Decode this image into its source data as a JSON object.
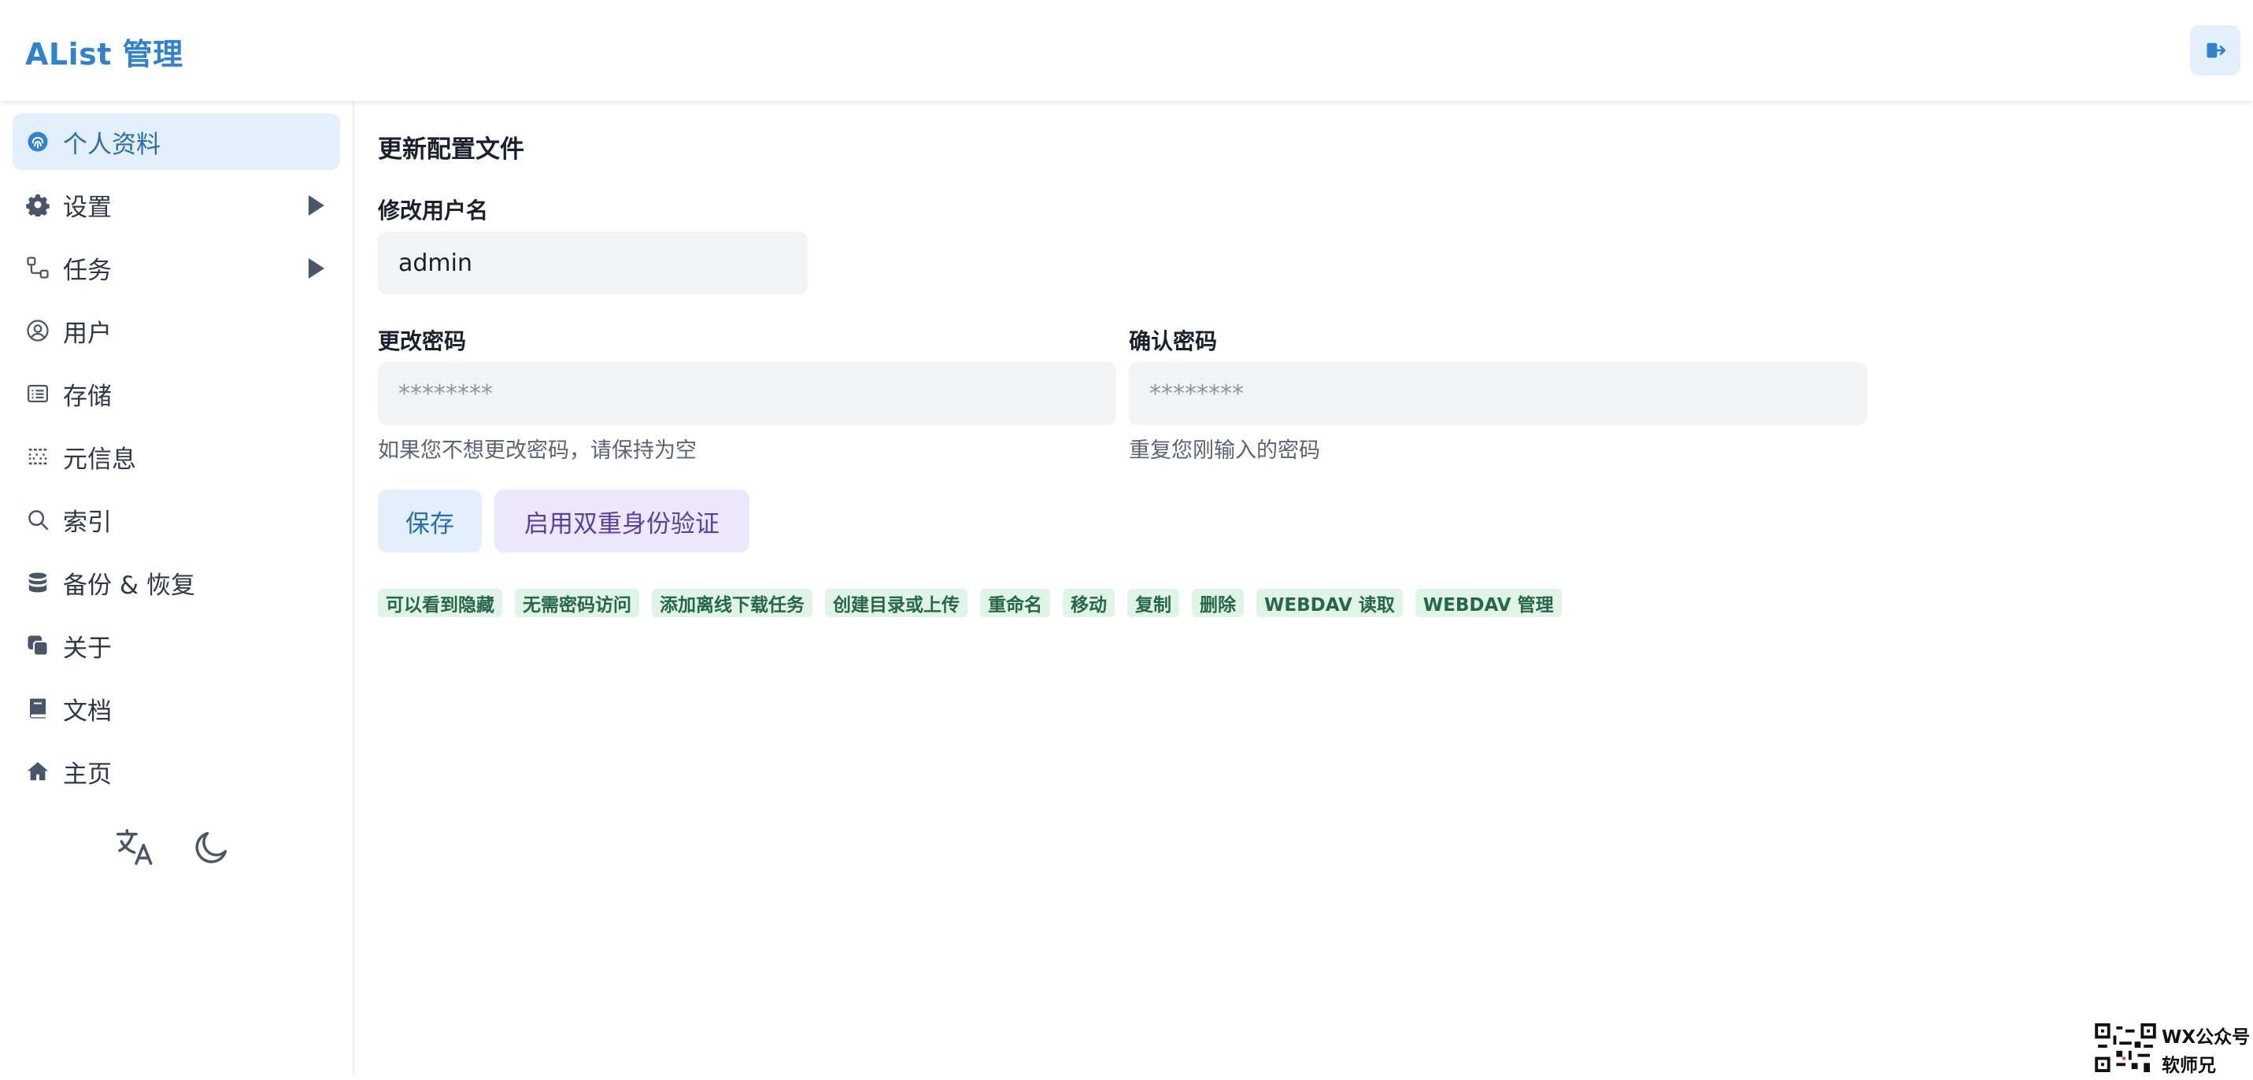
{
  "header": {
    "brand": "AList 管理",
    "logout_icon": "logout-icon"
  },
  "sidebar": {
    "items": [
      {
        "label": "个人资料",
        "icon": "fingerprint-icon",
        "active": true
      },
      {
        "label": "设置",
        "icon": "gear-icon",
        "expandable": true
      },
      {
        "label": "任务",
        "icon": "workflow-icon",
        "expandable": true
      },
      {
        "label": "用户",
        "icon": "user-circle-icon"
      },
      {
        "label": "存储",
        "icon": "storage-list-icon"
      },
      {
        "label": "元信息",
        "icon": "metadata-icon"
      },
      {
        "label": "索引",
        "icon": "search-icon"
      },
      {
        "label": "备份 & 恢复",
        "icon": "database-icon"
      },
      {
        "label": "关于",
        "icon": "copy-stack-icon"
      },
      {
        "label": "文档",
        "icon": "book-icon"
      },
      {
        "label": "主页",
        "icon": "home-icon"
      }
    ],
    "tools": {
      "language_icon": "translate-icon",
      "theme_icon": "moon-icon"
    }
  },
  "main": {
    "title": "更新配置文件",
    "username": {
      "label": "修改用户名",
      "value": "admin"
    },
    "password": {
      "label": "更改密码",
      "placeholder": "********",
      "helper": "如果您不想更改密码，请保持为空"
    },
    "confirm": {
      "label": "确认密码",
      "placeholder": "********",
      "helper": "重复您刚输入的密码"
    },
    "buttons": {
      "save": "保存",
      "enable_2fa": "启用双重身份验证"
    },
    "permissions": [
      "可以看到隐藏",
      "无需密码访问",
      "添加离线下载任务",
      "创建目录或上传",
      "重命名",
      "移动",
      "复制",
      "删除",
      "WEBDAV 读取",
      "WEBDAV 管理"
    ]
  },
  "watermark": {
    "line1": "WX公众号",
    "line2": "软师兄"
  },
  "colors": {
    "accent": "#3182ce",
    "active_bg": "#e3effb",
    "tag_bg": "#dff3e6",
    "tag_text": "#276749"
  }
}
